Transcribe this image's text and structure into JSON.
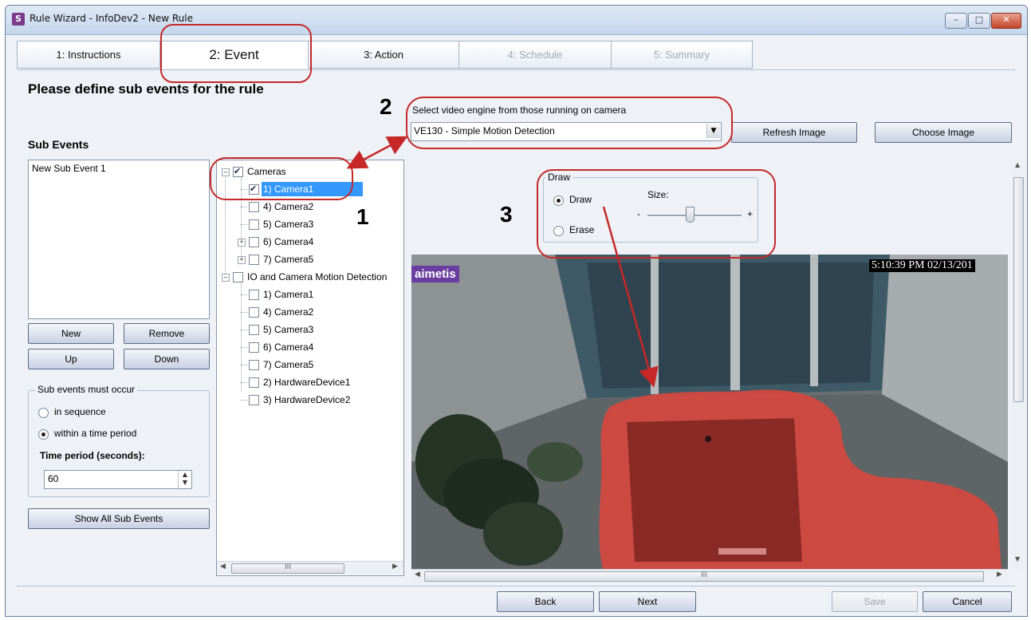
{
  "window": {
    "title": "Rule Wizard - InfoDev2 - New Rule",
    "app_icon": "S",
    "caption_buttons": [
      "minimize-icon",
      "maximize-icon",
      "close-icon"
    ]
  },
  "tabs": [
    {
      "label": "1: Instructions"
    },
    {
      "label": "2: Event"
    },
    {
      "label": "3: Action"
    },
    {
      "label": "4: Schedule"
    },
    {
      "label": "5: Summary"
    }
  ],
  "heading": "Please define sub events for the rule",
  "sub_events": {
    "label": "Sub Events",
    "items": [
      "New Sub Event 1"
    ],
    "buttons": {
      "new": "New",
      "remove": "Remove",
      "up": "Up",
      "down": "Down"
    },
    "order_group": {
      "title": "Sub events must occur",
      "options": [
        "in sequence",
        "within a time period"
      ],
      "selected": "within a time period"
    },
    "time_period_label": "Time period (seconds):",
    "time_period_value": "60",
    "show_all": "Show All Sub Events"
  },
  "tree": {
    "cameras_root": "Cameras",
    "cameras": [
      "1) Camera1",
      "4) Camera2",
      "5) Camera3",
      "6) Camera4",
      "7) Camera5"
    ],
    "io_root": "IO and Camera Motion Detection",
    "io_items": [
      "1) Camera1",
      "4) Camera2",
      "5) Camera3",
      "6) Camera4",
      "7) Camera5",
      "2) HardwareDevice1",
      "3) HardwareDevice2"
    ],
    "scroll_mark": "III"
  },
  "engine": {
    "label": "Select video engine from those running on camera",
    "value": "VE130 - Simple Motion Detection",
    "refresh": "Refresh Image",
    "choose": "Choose Image"
  },
  "draw": {
    "title": "Draw",
    "draw_label": "Draw",
    "erase_label": "Erase",
    "size_label": "Size:",
    "minus": "-",
    "plus": "+",
    "selected": "Draw"
  },
  "image": {
    "timestamp": "5:10:39 PM 02/13/201",
    "logo": "aimetis",
    "scroll_mark": "III"
  },
  "footer": {
    "back": "Back",
    "next": "Next",
    "save": "Save",
    "cancel": "Cancel"
  },
  "annotations": {
    "n1": "1",
    "n2": "2",
    "n3": "3",
    "color": "#c62828"
  }
}
